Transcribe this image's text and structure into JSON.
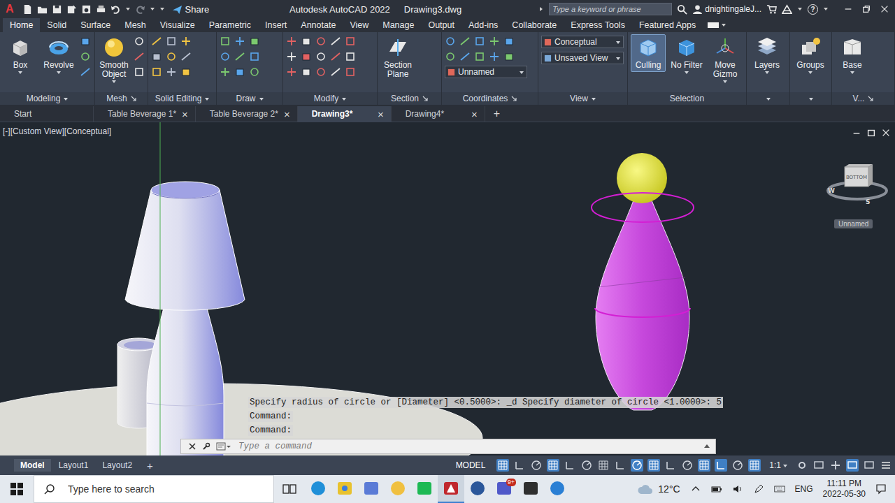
{
  "window": {
    "logo": "A",
    "title": "Autodesk AutoCAD 2022",
    "file": "Drawing3.dwg",
    "share": "Share",
    "search_placeholder": "Type a keyword or phrase",
    "user": "dnightingaleJ...",
    "help": "?"
  },
  "ribbon_tabs": [
    {
      "label": "Home",
      "selected": true
    },
    {
      "label": "Solid",
      "selected": false
    },
    {
      "label": "Surface",
      "selected": false
    },
    {
      "label": "Mesh",
      "selected": false
    },
    {
      "label": "Visualize",
      "selected": false
    },
    {
      "label": "Parametric",
      "selected": false
    },
    {
      "label": "Insert",
      "selected": false
    },
    {
      "label": "Annotate",
      "selected": false
    },
    {
      "label": "View",
      "selected": false
    },
    {
      "label": "Manage",
      "selected": false
    },
    {
      "label": "Output",
      "selected": false
    },
    {
      "label": "Add-ins",
      "selected": false
    },
    {
      "label": "Collaborate",
      "selected": false
    },
    {
      "label": "Express Tools",
      "selected": false
    },
    {
      "label": "Featured Apps",
      "selected": false
    }
  ],
  "ribbon_panels": [
    {
      "label": "Modeling",
      "footer": "dropdown",
      "tools": [
        {
          "label": "Box",
          "selected": false,
          "menu": true
        },
        {
          "label": "Revolve",
          "selected": false,
          "menu": true
        }
      ],
      "dropdowns": []
    },
    {
      "label": "Mesh",
      "footer": "launcher",
      "tools": [
        {
          "label": "Smooth Object",
          "selected": false,
          "menu": true
        }
      ],
      "dropdowns": []
    },
    {
      "label": "Solid Editing",
      "footer": "dropdown",
      "tools": [],
      "dropdowns": []
    },
    {
      "label": "Draw",
      "footer": "dropdown",
      "tools": [],
      "dropdowns": []
    },
    {
      "label": "Modify",
      "footer": "dropdown",
      "tools": [],
      "dropdowns": []
    },
    {
      "label": "Section",
      "footer": "launcher",
      "tools": [
        {
          "label": "Section Plane",
          "selected": false,
          "menu": false
        }
      ],
      "dropdowns": []
    },
    {
      "label": "Coordinates",
      "footer": "launcher",
      "tools": [],
      "dropdowns": [
        "Unnamed"
      ]
    },
    {
      "label": "View",
      "footer": "dropdown",
      "tools": [],
      "dropdowns": [
        "Conceptual",
        "Unsaved View"
      ]
    },
    {
      "label": "Selection",
      "footer": "none",
      "tools": [
        {
          "label": "Culling",
          "selected": true,
          "menu": false
        },
        {
          "label": "No Filter",
          "selected": false,
          "menu": true
        },
        {
          "label": "Move Gizmo",
          "selected": false,
          "menu": true
        }
      ],
      "dropdowns": []
    },
    {
      "label": "",
      "footer": "dropdown",
      "tools": [
        {
          "label": "Layers",
          "selected": false,
          "menu": true
        }
      ],
      "dropdowns": []
    },
    {
      "label": "",
      "footer": "dropdown",
      "tools": [
        {
          "label": "Groups",
          "selected": false,
          "menu": true
        }
      ],
      "dropdowns": []
    },
    {
      "label": "V...",
      "footer": "launcher",
      "tools": [
        {
          "label": "Base",
          "selected": false,
          "menu": true
        }
      ],
      "dropdowns": []
    }
  ],
  "file_tabs": {
    "close": "×",
    "new": "+",
    "items": [
      {
        "label": "Start",
        "selected": false,
        "closable": false
      },
      {
        "label": "Table Beverage 1*",
        "selected": false,
        "closable": true
      },
      {
        "label": "Table Beverage 2*",
        "selected": false,
        "closable": true
      },
      {
        "label": "Drawing3*",
        "selected": true,
        "closable": true
      },
      {
        "label": "Drawing4*",
        "selected": false,
        "closable": true
      }
    ]
  },
  "viewport": {
    "label": "[-][Custom View][Conceptual]",
    "viewcube_face": "BOTTOM",
    "compass": [
      "W",
      "S"
    ],
    "ucs": "Unnamed"
  },
  "command_line": {
    "history": [
      "Specify radius of circle or [Diameter] <0.5000>: _d Specify diameter of circle <1.0000>: 5",
      "Command:",
      "Command:"
    ],
    "placeholder": "Type a command"
  },
  "layout_tabs": {
    "new": "+",
    "items": [
      {
        "label": "Model",
        "selected": true
      },
      {
        "label": "Layout1",
        "selected": false
      },
      {
        "label": "Layout2",
        "selected": false
      }
    ]
  },
  "status_bar": {
    "space": "MODEL",
    "scale": "1:1",
    "toggles": [
      {
        "on": true
      },
      {
        "on": false
      },
      {
        "on": false
      },
      {
        "on": true
      },
      {
        "on": false
      },
      {
        "on": false
      },
      {
        "on": false
      },
      {
        "on": false
      },
      {
        "on": true
      },
      {
        "on": true
      },
      {
        "on": false
      },
      {
        "on": false
      },
      {
        "on": true
      },
      {
        "on": true
      },
      {
        "on": false
      },
      {
        "on": true
      },
      {
        "on": false
      },
      {
        "on": false
      },
      {
        "on": false
      },
      {
        "on": true
      },
      {
        "on": false
      }
    ]
  },
  "taskbar": {
    "search_placeholder": "Type here to search",
    "apps": [
      {
        "active": false,
        "badge": ""
      },
      {
        "active": false,
        "badge": ""
      },
      {
        "active": false,
        "badge": ""
      },
      {
        "active": false,
        "badge": ""
      },
      {
        "active": false,
        "badge": ""
      },
      {
        "active": true,
        "badge": ""
      },
      {
        "active": false,
        "badge": ""
      },
      {
        "active": false,
        "badge": "9+"
      },
      {
        "active": false,
        "badge": ""
      },
      {
        "active": false,
        "badge": ""
      }
    ],
    "temperature": "12°C",
    "language": "ENG",
    "time": "11:11 PM",
    "date": "2022-05-30"
  }
}
